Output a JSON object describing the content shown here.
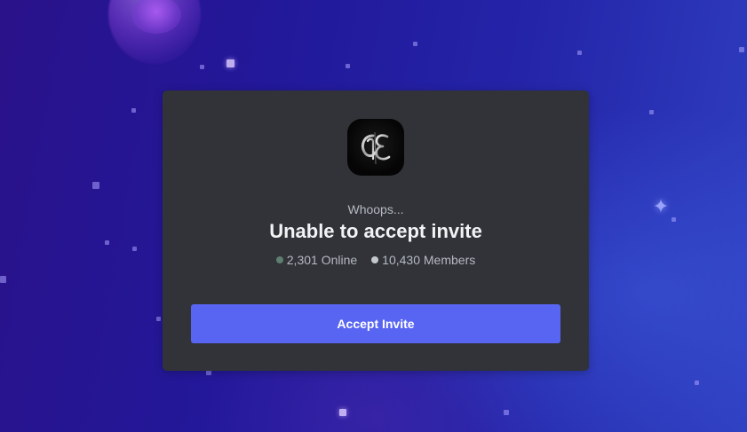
{
  "invite": {
    "subtitle": "Whoops...",
    "title": "Unable to accept invite",
    "online_count": "2,301 Online",
    "member_count": "10,430 Members",
    "accept_label": "Accept Invite"
  },
  "colors": {
    "card_background": "#313338",
    "button_background": "#5865f2",
    "online_dot": "#5e7f6f",
    "members_dot": "#c4c9ce"
  },
  "icons": {
    "server": "server-monogram-icon",
    "background": "sparkle-icon"
  }
}
